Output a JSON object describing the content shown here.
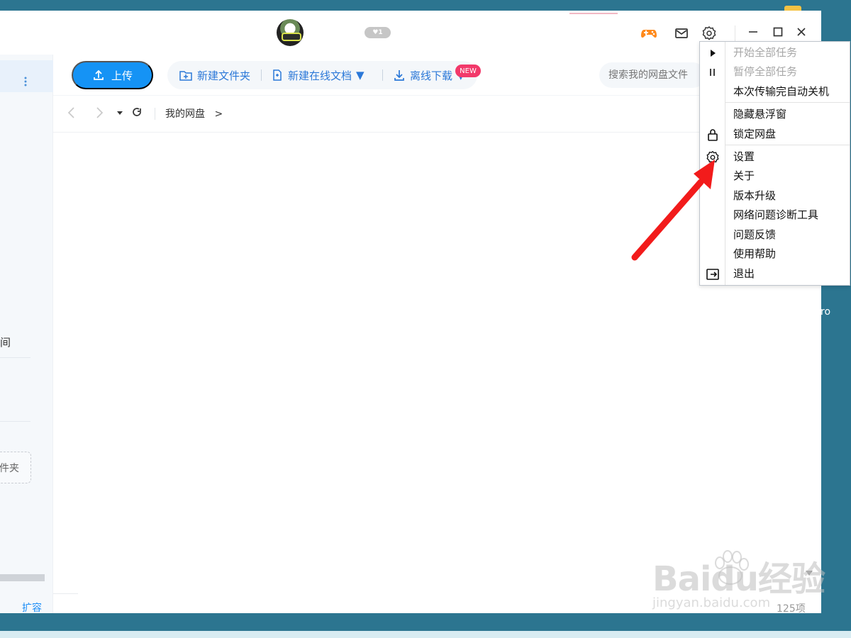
{
  "titlebar": {
    "vip_level": "1"
  },
  "toolbar": {
    "upload_label": "上传",
    "new_folder_label": "新建文件夹",
    "new_online_doc_label": "新建在线文档",
    "new_badge": "NEW",
    "offline_download_label": "离线下载",
    "search_placeholder": "搜索我的网盘文件"
  },
  "navigation": {
    "breadcrumb_root": "我的网盘",
    "breadcrumb_separator": ">"
  },
  "sidebar": {
    "partial_item": "间",
    "partial_folder": "件夹",
    "expand_label": "扩容"
  },
  "main": {
    "item_count": "125项"
  },
  "settings_menu": {
    "items": [
      {
        "label": "开始全部任务",
        "icon": "play-icon",
        "disabled": true
      },
      {
        "label": "暂停全部任务",
        "icon": "pause-icon",
        "disabled": true
      },
      {
        "label": "本次传输完自动关机",
        "icon": "",
        "disabled": false
      },
      {
        "label": "隐藏悬浮窗",
        "icon": "",
        "disabled": false
      },
      {
        "label": "锁定网盘",
        "icon": "lock-icon",
        "disabled": false
      },
      {
        "label": "设置",
        "icon": "gear-icon",
        "disabled": false
      },
      {
        "label": "关于",
        "icon": "",
        "disabled": false
      },
      {
        "label": "版本升级",
        "icon": "",
        "disabled": false
      },
      {
        "label": "网络问题诊断工具",
        "icon": "",
        "disabled": false
      },
      {
        "label": "问题反馈",
        "icon": "",
        "disabled": false
      },
      {
        "label": "使用帮助",
        "icon": "",
        "disabled": false
      },
      {
        "label": "退出",
        "icon": "exit-icon",
        "disabled": false
      }
    ]
  },
  "desktop": {
    "partial_label": "ro"
  },
  "watermark": {
    "brand": "Baidu经验",
    "domain": "jingyan.baidu.com"
  },
  "colors": {
    "accent": "#1593f5",
    "annotation_arrow": "#f21b1b",
    "desktop": "#2c7590",
    "new_badge": "#f2396a"
  }
}
